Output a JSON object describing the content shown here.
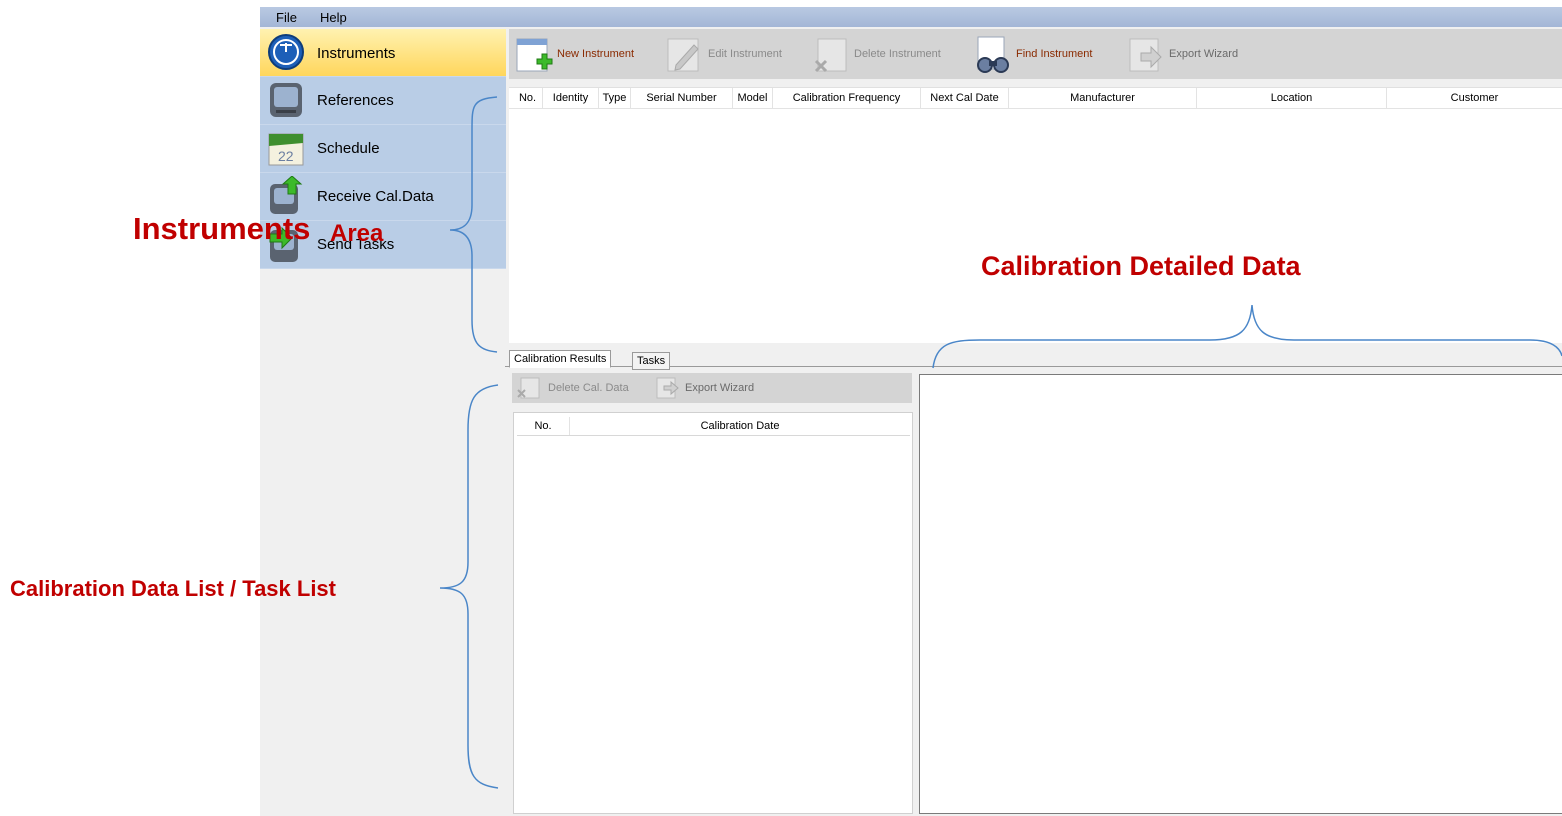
{
  "menu": {
    "file": "File",
    "help": "Help"
  },
  "sidebar": {
    "items": [
      {
        "label": "Instruments"
      },
      {
        "label": "References"
      },
      {
        "label": "Schedule"
      },
      {
        "label": "Receive Cal.Data"
      },
      {
        "label": "Send Tasks"
      }
    ],
    "calendar_icon_number": "22"
  },
  "toolbar": {
    "new_instrument": "New Instrument",
    "edit_instrument": "Edit Instrument",
    "delete_instrument": "Delete Instrument",
    "find_instrument": "Find Instrument",
    "export_wizard": "Export Wizard"
  },
  "instruments_table": {
    "columns": [
      "No.",
      "Identity",
      "Type",
      "Serial Number",
      "Model",
      "Calibration Frequency",
      "Next Cal Date",
      "Manufacturer",
      "Location",
      "Customer"
    ]
  },
  "tabs": {
    "calibration_results": "Calibration Results",
    "tasks": "Tasks"
  },
  "cal_toolbar": {
    "delete_cal_data": "Delete Cal. Data",
    "export_wizard": "Export Wizard"
  },
  "cal_table": {
    "columns": [
      "No.",
      "Calibration Date"
    ]
  },
  "annotations": {
    "instruments_area_a": "Instruments",
    "instruments_area_b": "Area",
    "detailed_data": "Calibration Detailed Data",
    "data_list": "Calibration Data List / Task List"
  },
  "colors": {
    "menubar": "#a3b6d6",
    "sidebar": "#b9cde6",
    "active_item": "#ffd65c",
    "annotation": "#c00000",
    "bracket": "#4a86c8",
    "link_text": "#8a2a00"
  }
}
